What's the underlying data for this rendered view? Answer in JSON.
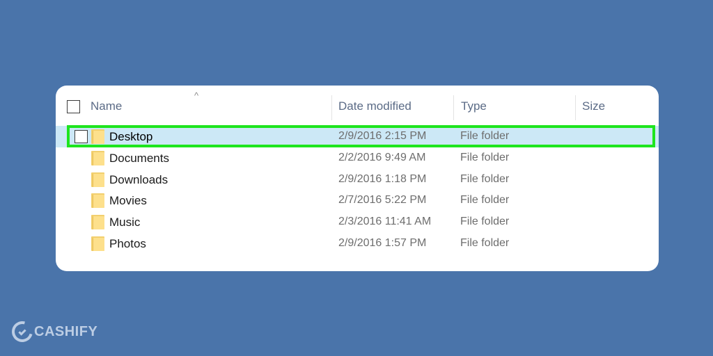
{
  "explorer": {
    "columns": {
      "name": "Name",
      "date_modified": "Date modified",
      "type": "Type",
      "size": "Size"
    },
    "sort_indicator": "^",
    "rows": [
      {
        "name": "Desktop",
        "date_modified": "2/9/2016 2:15 PM",
        "type": "File folder",
        "selected": true
      },
      {
        "name": "Documents",
        "date_modified": "2/2/2016 9:49 AM",
        "type": "File folder"
      },
      {
        "name": "Downloads",
        "date_modified": "2/9/2016 1:18 PM",
        "type": "File folder"
      },
      {
        "name": "Movies",
        "date_modified": "2/7/2016 5:22 PM",
        "type": "File folder"
      },
      {
        "name": "Music",
        "date_modified": "2/3/2016 11:41 AM",
        "type": "File folder"
      },
      {
        "name": "Photos",
        "date_modified": "2/9/2016 1:57 PM",
        "type": "File folder"
      }
    ]
  },
  "brand": {
    "name": "CASHIFY"
  },
  "colors": {
    "background": "#4a74aa",
    "panel": "#ffffff",
    "selection": "#cce8f6",
    "highlight": "#1ee51e",
    "folder": "#fde08c"
  },
  "icons": {
    "folder": "folder-icon",
    "checkbox": "checkbox-icon",
    "brand": "cashify-logo-icon"
  }
}
